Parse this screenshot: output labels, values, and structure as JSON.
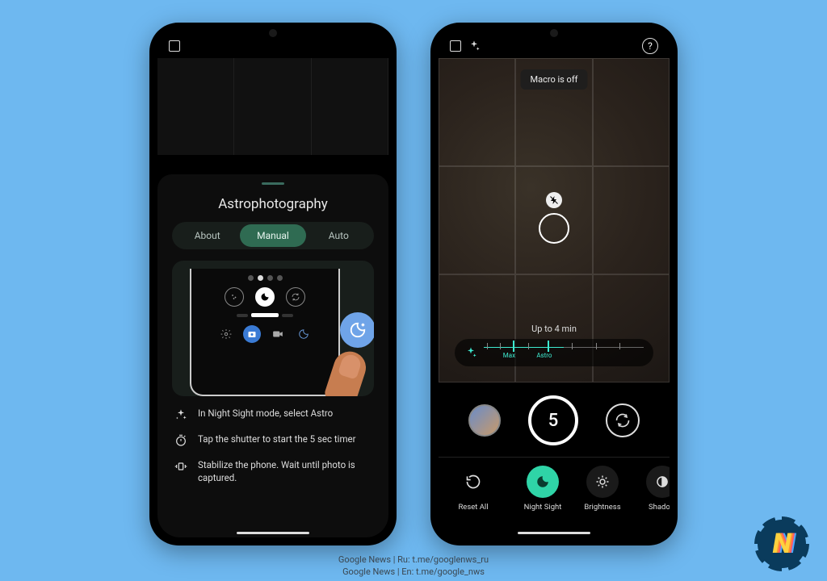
{
  "left": {
    "sheet_title": "Astrophotography",
    "tabs": {
      "about": "About",
      "manual": "Manual",
      "auto": "Auto",
      "active": "manual"
    },
    "steps": [
      "In Night Sight mode, select Astro",
      "Tap the shutter to start the 5 sec timer",
      "Stabilize the phone. Wait until photo is captured."
    ]
  },
  "right": {
    "toast": "Macro is off",
    "exposure_label": "Up to 4 min",
    "scale_labels": {
      "max": "Max",
      "astro": "Astro"
    },
    "shutter_count": "5",
    "modes": [
      {
        "id": "reset",
        "label": "Reset All"
      },
      {
        "id": "nightsight",
        "label": "Night Sight"
      },
      {
        "id": "brightness",
        "label": "Brightness"
      },
      {
        "id": "shadow",
        "label": "Shadow"
      }
    ]
  },
  "footer": {
    "line1": "Google News | Ru: t.me/googlenws_ru",
    "line2": "Google News | En: t.me/google_nws"
  }
}
